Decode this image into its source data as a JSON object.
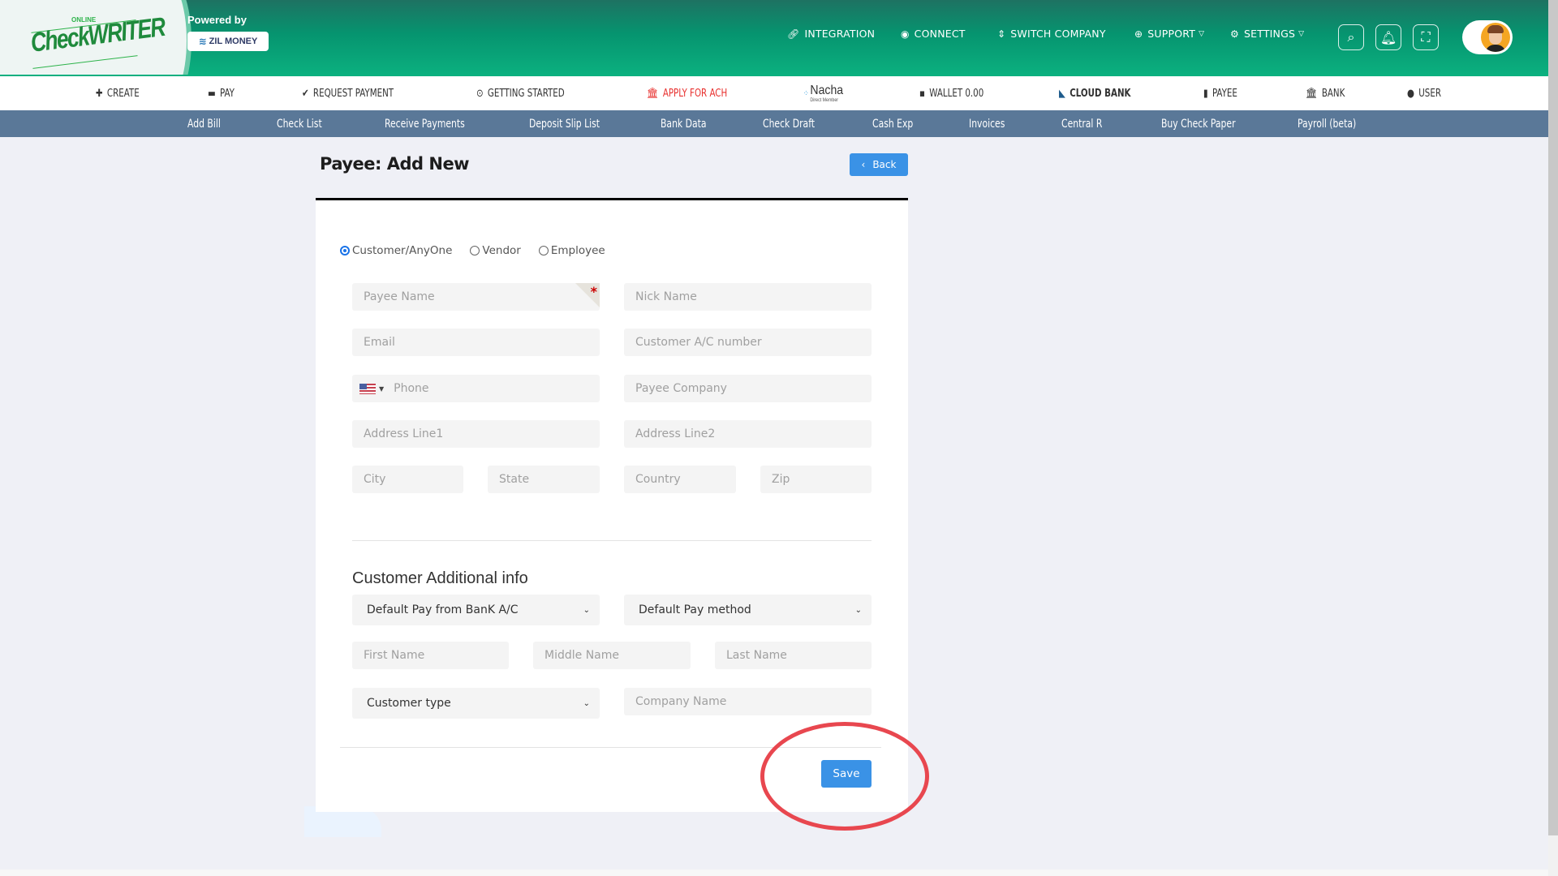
{
  "brand": {
    "logo_top": "ONLINE",
    "logo_name": "CheckWRITER",
    "powered_by": "Powered by",
    "partner": "ZIL MONEY"
  },
  "top_menu": [
    {
      "label": "INTEGRATION",
      "icon": "link-icon"
    },
    {
      "label": "CONNECT",
      "icon": "connect-icon"
    },
    {
      "label": "SWITCH COMPANY",
      "icon": "switch-arrows-icon"
    },
    {
      "label": "SUPPORT",
      "icon": "lifebuoy-icon",
      "dropdown": true
    },
    {
      "label": "SETTINGS",
      "icon": "gear-icon",
      "dropdown": true
    }
  ],
  "nav": [
    {
      "label": "CREATE",
      "icon": "plus-icon"
    },
    {
      "label": "PAY",
      "icon": "check-card-icon"
    },
    {
      "label": "REQUEST PAYMENT",
      "icon": "check-circle-icon"
    },
    {
      "label": "GETTING STARTED",
      "icon": "play-circle-icon"
    },
    {
      "label": "APPLY FOR ACH",
      "icon": "bank-icon"
    },
    {
      "label": "Nacha",
      "sublabel": "Direct Member",
      "icon": "nacha-logo"
    },
    {
      "label": "WALLET 0.00",
      "icon": "wallet-icon"
    },
    {
      "label": "CLOUD BANK",
      "icon": "cloud-bank-icon"
    },
    {
      "label": "PAYEE",
      "icon": "payee-icon"
    },
    {
      "label": "BANK",
      "icon": "bank-icon"
    },
    {
      "label": "USER",
      "icon": "user-circle-icon"
    }
  ],
  "subnav": [
    "Add Bill",
    "Check List",
    "Receive Payments",
    "Deposit Slip List",
    "Bank Data",
    "Check Draft",
    "Cash Exp",
    "Invoices",
    "Central R",
    "Buy Check Paper",
    "Payroll (beta)"
  ],
  "page": {
    "title": "Payee: Add New",
    "back_label": "Back"
  },
  "payee_types": [
    {
      "label": "Customer/AnyOne",
      "selected": true
    },
    {
      "label": "Vendor",
      "selected": false
    },
    {
      "label": "Employee",
      "selected": false
    }
  ],
  "fields": {
    "payee_name": {
      "placeholder": "Payee Name",
      "required_mark": "*"
    },
    "nick_name": {
      "placeholder": "Nick Name"
    },
    "email": {
      "placeholder": "Email"
    },
    "account_number": {
      "placeholder": "Customer A/C number"
    },
    "phone": {
      "placeholder": "Phone",
      "country": "US"
    },
    "payee_company": {
      "placeholder": "Payee Company"
    },
    "address1": {
      "placeholder": "Address Line1"
    },
    "address2": {
      "placeholder": "Address Line2"
    },
    "city": {
      "placeholder": "City"
    },
    "state": {
      "placeholder": "State"
    },
    "country": {
      "placeholder": "Country"
    },
    "zip": {
      "placeholder": "Zip"
    }
  },
  "additional": {
    "title": "Customer Additional info",
    "pay_from_bank": "Default Pay from BanK A/C",
    "pay_method": "Default Pay method",
    "first_name": "First Name",
    "middle_name": "Middle Name",
    "last_name": "Last Name",
    "customer_type": "Customer type",
    "company_name": "Company Name"
  },
  "save_label": "Save",
  "colors": {
    "header_green": "#06946f",
    "subnav_blue": "#5a7898",
    "primary_button": "#3a92e6",
    "ach_red": "#e8312f",
    "annotation_red": "#e8474f"
  }
}
